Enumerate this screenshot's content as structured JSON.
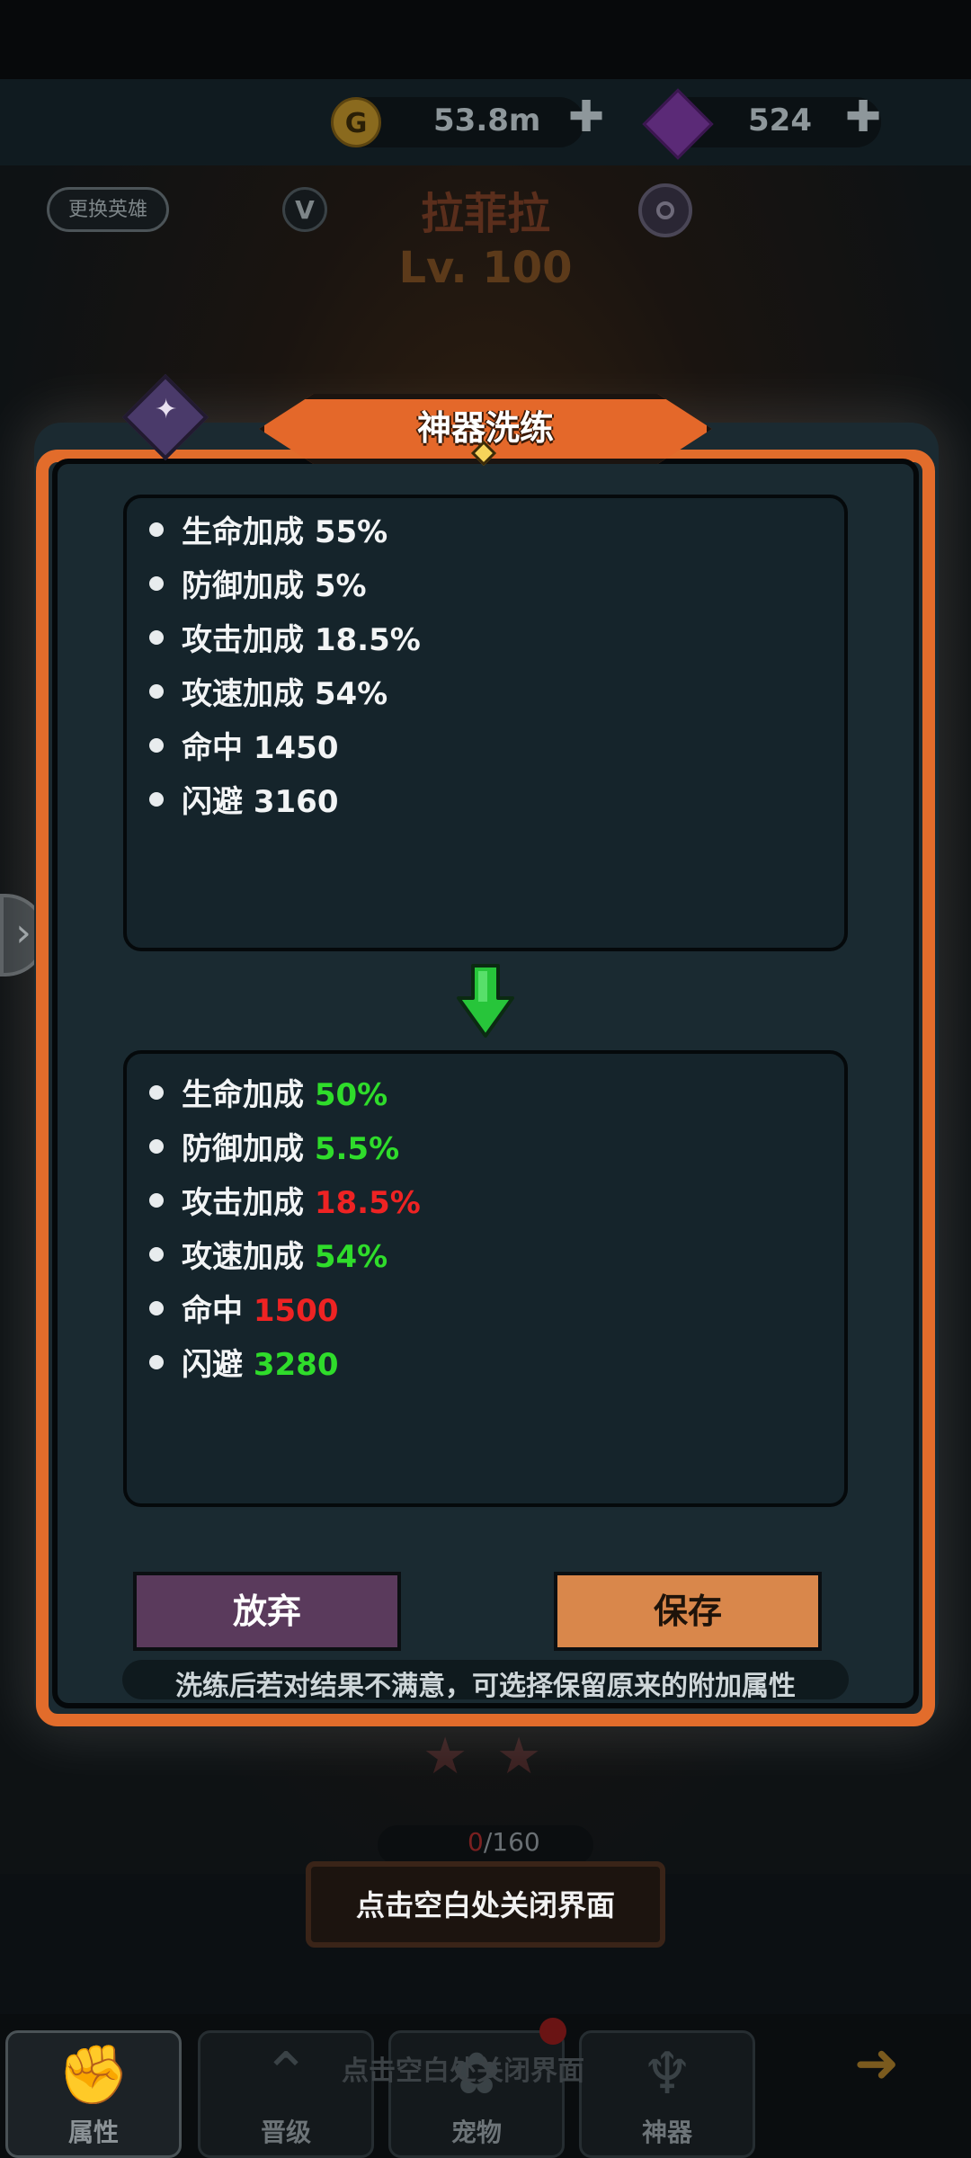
{
  "resources": {
    "gold": "53.8m",
    "gems": "524",
    "add_symbol": "✚",
    "gold_icon": "G"
  },
  "hero": {
    "change_label": "更换英雄",
    "v_icon": "V",
    "name": "拉菲拉",
    "level": "Lv. 100"
  },
  "modal": {
    "title": "神器洗练",
    "current": [
      {
        "name": "生命加成",
        "value": "55%"
      },
      {
        "name": "防御加成",
        "value": "5%"
      },
      {
        "name": "攻击加成",
        "value": "18.5%"
      },
      {
        "name": "攻速加成",
        "value": "54%"
      },
      {
        "name": "命中",
        "value": "1450"
      },
      {
        "name": "闪避",
        "value": "3160"
      }
    ],
    "new": [
      {
        "name": "生命加成",
        "value": "50%",
        "trend": "up"
      },
      {
        "name": "防御加成",
        "value": "5.5%",
        "trend": "up"
      },
      {
        "name": "攻击加成",
        "value": "18.5%",
        "trend": "down"
      },
      {
        "name": "攻速加成",
        "value": "54%",
        "trend": "up"
      },
      {
        "name": "命中",
        "value": "1500",
        "trend": "down"
      },
      {
        "name": "闪避",
        "value": "3280",
        "trend": "up"
      }
    ],
    "discard_label": "放弃",
    "save_label": "保存",
    "hint": "洗练后若对结果不满意，可选择保留原来的附加属性"
  },
  "background": {
    "exp_current": "0",
    "exp_total": "/160",
    "close_hint": "点击空白处关闭界面",
    "bottom_hint": "点击空白处关闭界面"
  },
  "tabs": [
    {
      "label": "属性",
      "active": true
    },
    {
      "label": "晋级"
    },
    {
      "label": "宠物"
    },
    {
      "label": "神器"
    }
  ],
  "colors": {
    "accent": "#e26c2b",
    "up": "#2fdc2b",
    "down": "#ee2323",
    "discard": "#5a3a5c",
    "save": "#d9874b"
  }
}
